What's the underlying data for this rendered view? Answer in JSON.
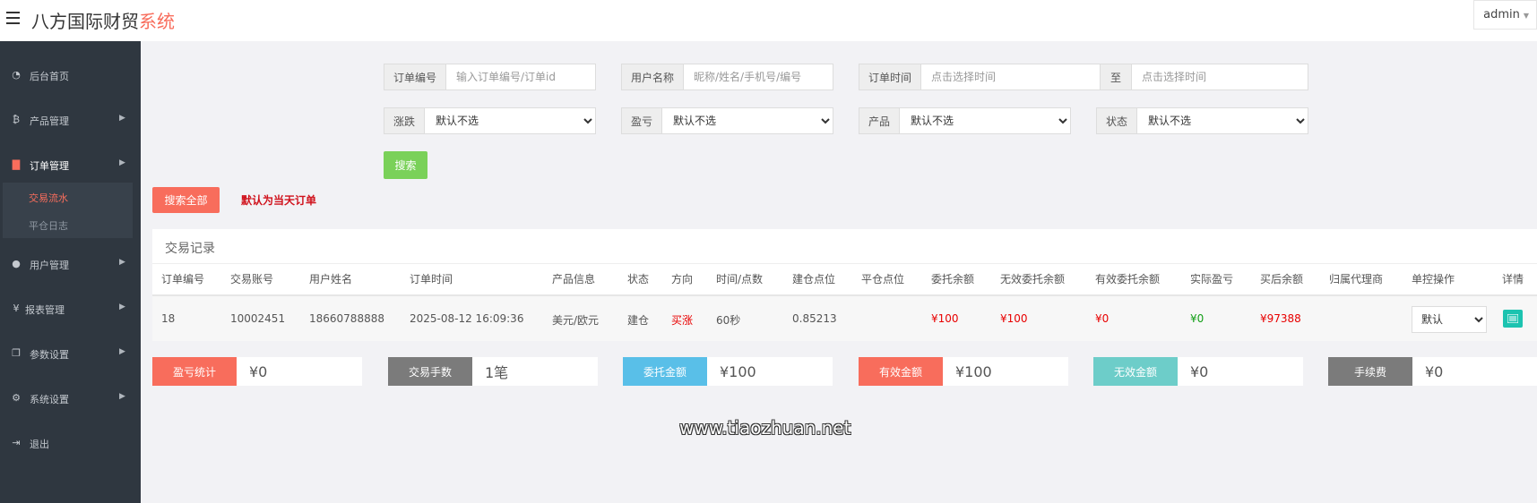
{
  "header": {
    "brand_main": "八方国际财贸",
    "brand_accent": "系统",
    "user": "admin"
  },
  "sidebar": {
    "items": [
      {
        "label": "后台首页",
        "icon": "dashboard-icon"
      },
      {
        "label": "产品管理",
        "icon": "bitcoin-icon"
      },
      {
        "label": "订单管理",
        "icon": "file-icon"
      },
      {
        "label": "用户管理",
        "icon": "user-icon"
      },
      {
        "label": "报表管理",
        "icon": "yen-icon"
      },
      {
        "label": "参数设置",
        "icon": "copy-icon"
      },
      {
        "label": "系统设置",
        "icon": "cogs-icon"
      },
      {
        "label": "退出",
        "icon": "signout-icon"
      }
    ],
    "submenu": [
      "交易流水",
      "平仓日志"
    ]
  },
  "filters": {
    "order_no": {
      "label": "订单编号",
      "placeholder": "输入订单编号/订单id"
    },
    "username": {
      "label": "用户名称",
      "placeholder": "昵称/姓名/手机号/编号"
    },
    "order_time": {
      "label": "订单时间",
      "placeholder": "点击选择时间"
    },
    "to": {
      "label": "至",
      "placeholder": "点击选择时间"
    },
    "rise_fall": {
      "label": "涨跌",
      "value": "默认不选"
    },
    "profit_loss": {
      "label": "盈亏",
      "value": "默认不选"
    },
    "product": {
      "label": "产品",
      "value": "默认不选"
    },
    "status": {
      "label": "状态",
      "value": "默认不选"
    },
    "search_button": "搜索",
    "search_all_button": "搜索全部",
    "default_hint": "默认为当天订单"
  },
  "records": {
    "title": "交易记录",
    "columns": [
      "订单编号",
      "交易账号",
      "用户姓名",
      "订单时间",
      "产品信息",
      "状态",
      "方向",
      "时间/点数",
      "建仓点位",
      "平仓点位",
      "委托余额",
      "无效委托余额",
      "有效委托余额",
      "实际盈亏",
      "买后余额",
      "归属代理商",
      "单控操作",
      "详情"
    ],
    "rows": [
      {
        "order_no": "18",
        "account": "10002451",
        "user_name": "18660788888",
        "order_time": "2025-08-12 16:09:36",
        "product": "美元/欧元",
        "status": "建仓",
        "direction": "买涨",
        "time_points": "60秒",
        "open_point": "0.85213",
        "close_point": "",
        "entrust_balance": "¥100",
        "invalid_entrust": "¥100",
        "valid_entrust": "¥0",
        "actual_pl": "¥0",
        "after_balance": "¥97388",
        "agent": "",
        "control": "默认"
      }
    ]
  },
  "stats": [
    {
      "label": "盈亏统计",
      "value": "¥0",
      "color": "#f86d5c"
    },
    {
      "label": "交易手数",
      "value": "1笔",
      "color": "#7b7b7b"
    },
    {
      "label": "委托金额",
      "value": "¥100",
      "color": "#59bfe8"
    },
    {
      "label": "有效金额",
      "value": "¥100",
      "color": "#f86d5c"
    },
    {
      "label": "无效金额",
      "value": "¥0",
      "color": "#6dcdc9"
    },
    {
      "label": "手续费",
      "value": "¥0",
      "color": "#7b7b7b"
    }
  ],
  "watermark": "www.tiaozhuan.net",
  "colors": {
    "accent": "#f86d5c",
    "sidebar": "#2f3740",
    "search_green": "#7ad159"
  }
}
